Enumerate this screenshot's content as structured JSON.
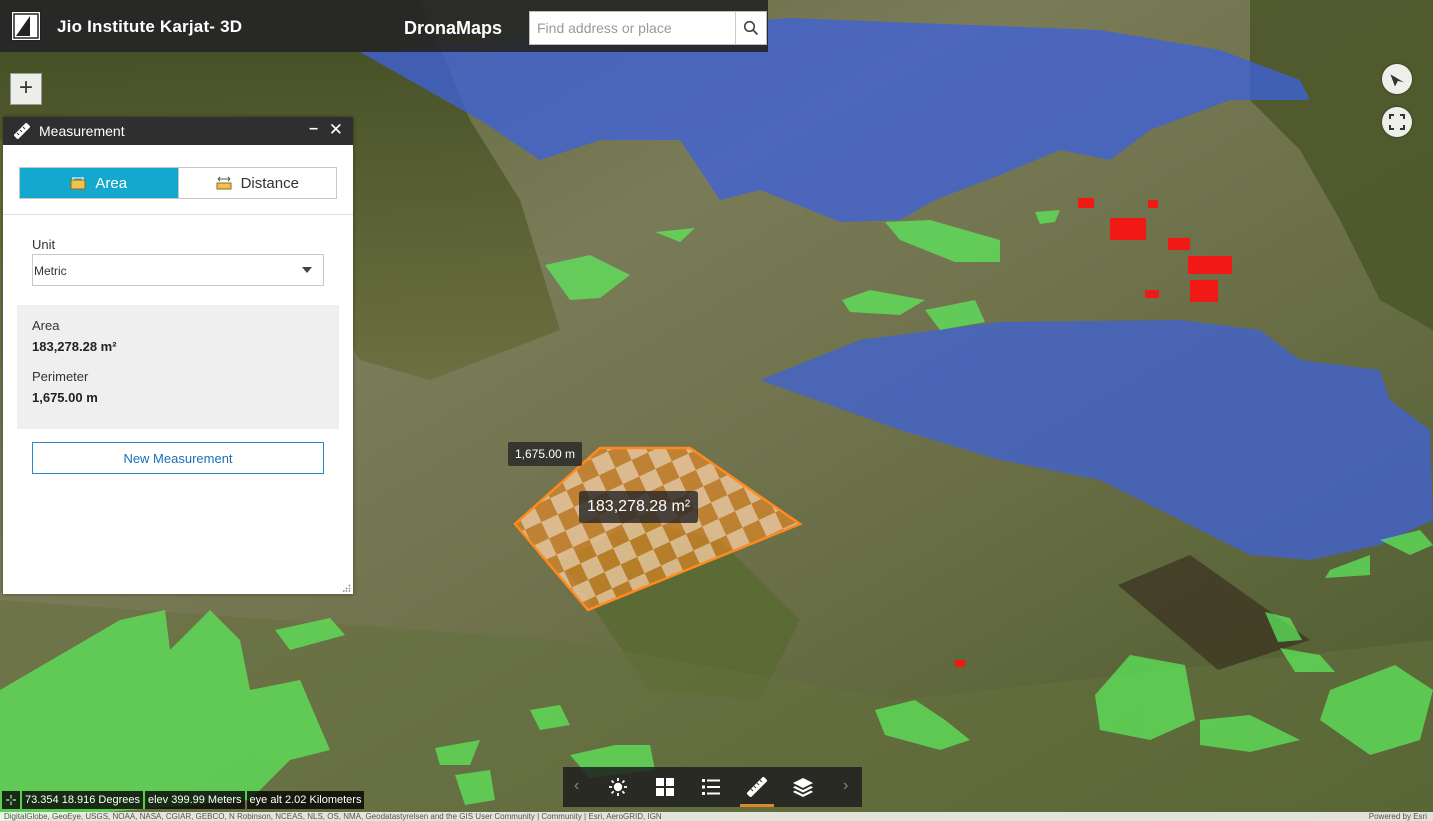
{
  "header": {
    "title": "Jio Institute Karjat- 3D",
    "brand": "DronaMaps",
    "search_placeholder": "Find address or place"
  },
  "map_controls": {
    "zoom_in_label": "+"
  },
  "measurement": {
    "title": "Measurement",
    "minimize_label": "–",
    "close_label": "✕",
    "tabs": [
      {
        "label": "Area",
        "active": true
      },
      {
        "label": "Distance",
        "active": false
      }
    ],
    "unit_label": "Unit",
    "unit_value": "Metric",
    "area_label": "Area",
    "area_value": "183,278.28 m²",
    "perimeter_label": "Perimeter",
    "perimeter_value": "1,675.00 m",
    "new_button_label": "New Measurement"
  },
  "map_labels": {
    "perimeter_tooltip": "1,675.00 m",
    "area_tooltip": "183,278.28 m²"
  },
  "toolbar": {
    "items": [
      "sun-icon",
      "grid-icon",
      "list-icon",
      "ruler-icon",
      "layers-icon"
    ],
    "active": "ruler-icon",
    "prev_label": "‹",
    "next_label": "›"
  },
  "coordinates": {
    "lonlat": "73.354 18.916 Degrees",
    "elevation": "elev 399.99 Meters",
    "eye_alt": "eye alt 2.02 Kilometers"
  },
  "attribution": {
    "left": "DigitalGlobe, GeoEye, USGS, NOAA, NASA, CGIAR, GEBCO, N Robinson, NCEAS, NLS, OS, NMA, Geodatastyrelsen and the GIS User Community | Community | Esri, AeroGRID, IGN",
    "right": "Powered by Esri"
  },
  "colors": {
    "accent": "#14a8cf",
    "header_bg": "#262626",
    "measure_orange": "#ff8a1f",
    "water_blue": "#3f62d8",
    "green_parcel": "#5df05d",
    "red_marker": "#ff1010"
  }
}
